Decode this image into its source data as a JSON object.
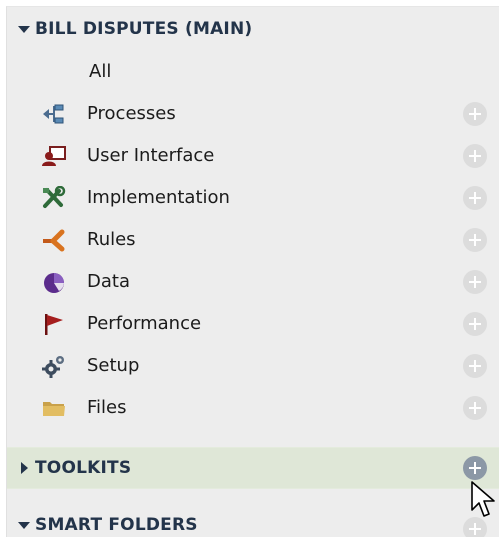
{
  "sections": {
    "main": {
      "title": "BILL DISPUTES (MAIN)",
      "expanded": true
    },
    "toolkits": {
      "title": "TOOLKITS",
      "expanded": false
    },
    "smart": {
      "title": "SMART FOLDERS",
      "expanded": true
    }
  },
  "items": [
    {
      "label": "All",
      "icon": null
    },
    {
      "label": "Processes",
      "icon": "process-flow-icon"
    },
    {
      "label": "User Interface",
      "icon": "user-interface-icon"
    },
    {
      "label": "Implementation",
      "icon": "tools-icon"
    },
    {
      "label": "Rules",
      "icon": "rules-icon"
    },
    {
      "label": "Data",
      "icon": "data-pie-icon"
    },
    {
      "label": "Performance",
      "icon": "flag-icon"
    },
    {
      "label": "Setup",
      "icon": "gears-icon"
    },
    {
      "label": "Files",
      "icon": "folder-icon"
    }
  ],
  "colors": {
    "panel_bg": "#ededed",
    "header_text": "#23344a",
    "toolkits_highlight": "#dfe7d7",
    "plus_idle": "#dcdcdc",
    "plus_hover": "#8c98a6"
  }
}
